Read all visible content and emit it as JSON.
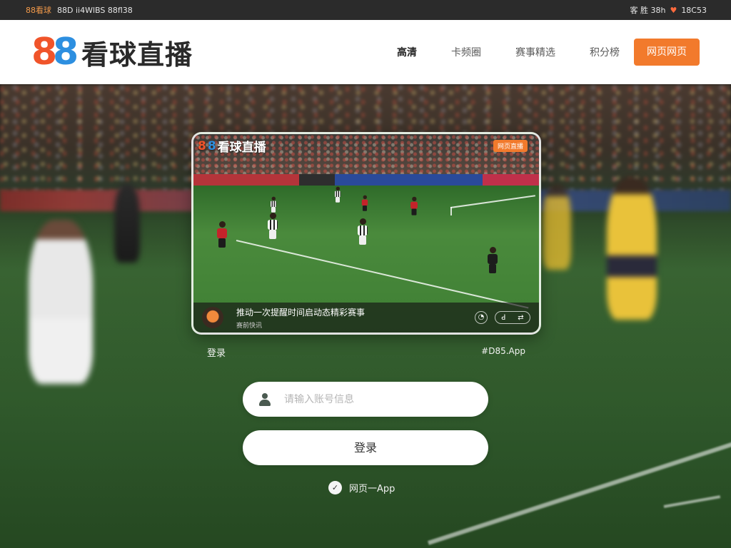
{
  "sysbar": {
    "left_brand": "88看球",
    "left_text": "88D ii4WlBS 88fl38",
    "right_text": "客 胜 38h",
    "right_score": "18C53"
  },
  "header": {
    "logo_digit_1": "8",
    "logo_digit_2": "8",
    "logo_text": "看球直播",
    "nav": [
      {
        "label": "高清",
        "active": true
      },
      {
        "label": "卡频圈",
        "active": false
      },
      {
        "label": "赛事精选",
        "active": false
      },
      {
        "label": "积分榜",
        "active": false
      }
    ],
    "cta": "网页网页"
  },
  "video": {
    "logo_text": "看球直播",
    "badge": "网页直播",
    "title": "推动一次提醒时间启动态精彩赛事",
    "subtitle": "赛前快讯",
    "controls": [
      "◔",
      "ꓒ",
      "⇄"
    ]
  },
  "under_card": {
    "left": "登录",
    "right": "#D85.App"
  },
  "login": {
    "username_placeholder": "请输入账号信息",
    "button": "登录",
    "app_link": "网页一App"
  },
  "colors": {
    "accent": "#f27a2c",
    "logo_orange": "#f0542a",
    "logo_blue": "#2d8fe0",
    "header_bg": "#ffffff",
    "sysbar_bg": "#2b2b2b"
  },
  "icons": {
    "user": "user-icon",
    "app": "app-icon",
    "heart": "heart-icon"
  }
}
